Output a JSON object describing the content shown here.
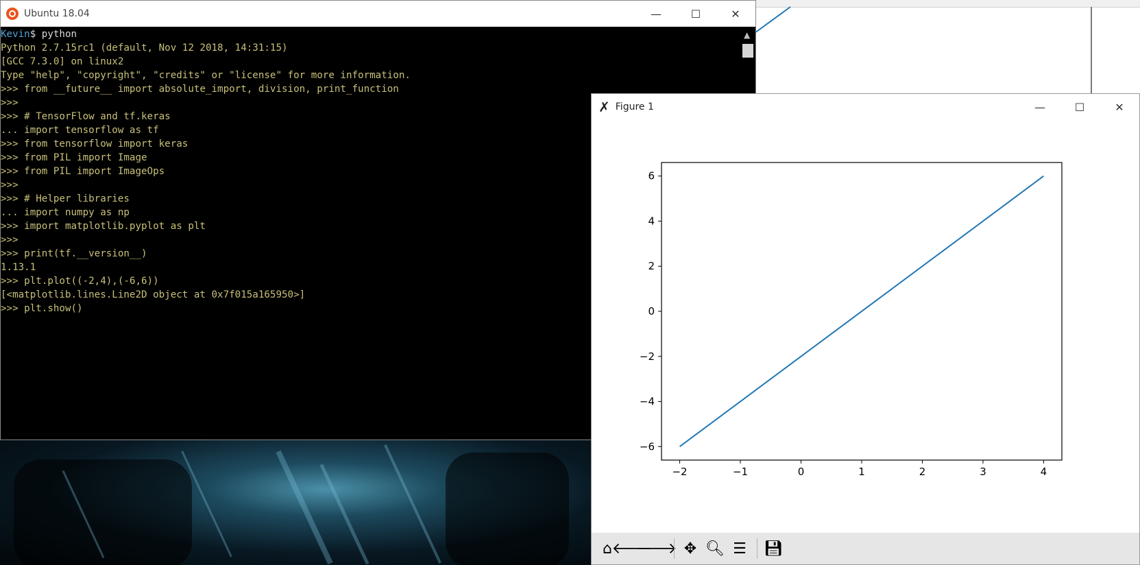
{
  "terminal": {
    "title": "Ubuntu 18.04",
    "lines": [
      {
        "user": "Kevin",
        "rest": "$ python"
      },
      {
        "text": "Python 2.7.15rc1 (default, Nov 12 2018, 14:31:15)"
      },
      {
        "text": "[GCC 7.3.0] on linux2"
      },
      {
        "text": "Type \"help\", \"copyright\", \"credits\" or \"license\" for more information."
      },
      {
        "text": ">>> from __future__ import absolute_import, division, print_function"
      },
      {
        "text": ">>>"
      },
      {
        "text": ">>> # TensorFlow and tf.keras"
      },
      {
        "text": "... import tensorflow as tf"
      },
      {
        "text": ">>> from tensorflow import keras"
      },
      {
        "text": ">>> from PIL import Image"
      },
      {
        "text": ">>> from PIL import ImageOps"
      },
      {
        "text": ">>>"
      },
      {
        "text": ">>> # Helper libraries"
      },
      {
        "text": "... import numpy as np"
      },
      {
        "text": ">>> import matplotlib.pyplot as plt"
      },
      {
        "text": ">>>"
      },
      {
        "text": ">>> print(tf.__version__)"
      },
      {
        "text": "1.13.1"
      },
      {
        "text": ">>> plt.plot((-2,4),(-6,6))"
      },
      {
        "text": "[<matplotlib.lines.Line2D object at 0x7f015a165950>]"
      },
      {
        "text": ">>> plt.show()"
      }
    ]
  },
  "figure": {
    "title": "Figure 1",
    "toolbar": [
      "home-icon",
      "back-icon",
      "forward-icon",
      "pan-icon",
      "zoom-icon",
      "configure-subplots-icon",
      "save-icon"
    ]
  },
  "window_buttons": {
    "minimize": "—",
    "maximize": "☐",
    "close": "✕"
  },
  "chart_data": {
    "type": "line",
    "title": "",
    "xlabel": "",
    "ylabel": "",
    "x": [
      -2,
      4
    ],
    "series": [
      {
        "values": [
          -6,
          6
        ],
        "color": "#1f77b4"
      }
    ],
    "xticks": [
      -2,
      -1,
      0,
      1,
      2,
      3,
      4
    ],
    "yticks": [
      -6,
      -4,
      -2,
      0,
      2,
      4,
      6
    ],
    "xlim": [
      -2.3,
      4.3
    ],
    "ylim": [
      -6.6,
      6.6
    ],
    "grid": false
  }
}
